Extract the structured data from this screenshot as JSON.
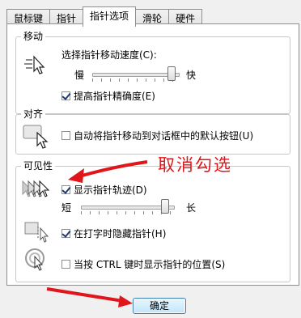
{
  "tabs": [
    {
      "label": "鼠标键"
    },
    {
      "label": "指针"
    },
    {
      "label": "指针选项"
    },
    {
      "label": "滑轮"
    },
    {
      "label": "硬件"
    }
  ],
  "motion": {
    "title": "移动",
    "speed_label": "选择指针移动速度(C):",
    "slow_label": "慢",
    "fast_label": "快",
    "speed_level": 0.95,
    "precision_label": "提高指针精确度(E)",
    "precision_checked": true
  },
  "snap": {
    "title": "对齐",
    "snap_label": "自动将指针移动到对话框中的默认按钮(U)",
    "snap_checked": false
  },
  "visibility": {
    "title": "可见性",
    "trails_label": "显示指针轨迹(D)",
    "trails_checked": true,
    "short_label": "短",
    "long_label": "长",
    "trail_level": 0.93,
    "hide_label": "在打字时隐藏指针(H)",
    "hide_checked": true,
    "ctrl_label": "当按 CTRL 键时显示指针的位置(S)",
    "ctrl_checked": false
  },
  "annotation": {
    "text": "取消勾选",
    "color": "#e0161a"
  },
  "ok_button": {
    "label": "确定"
  },
  "icons": [
    "pointer-speed-icon",
    "snap-to-icon",
    "pointer-trails-icon",
    "hide-pointer-icon",
    "show-location-icon"
  ]
}
